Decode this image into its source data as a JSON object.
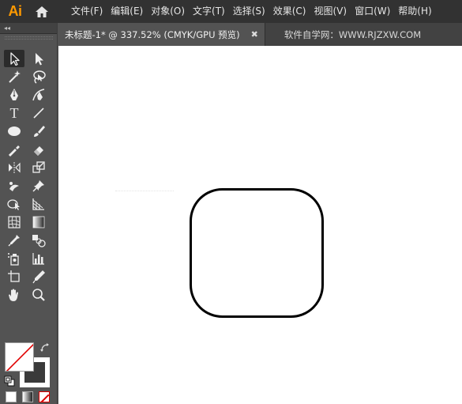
{
  "app": {
    "logo_text": "Ai",
    "home_icon": "home-icon"
  },
  "menu": [
    {
      "label": "文件(F)"
    },
    {
      "label": "编辑(E)"
    },
    {
      "label": "对象(O)"
    },
    {
      "label": "文字(T)"
    },
    {
      "label": "选择(S)"
    },
    {
      "label": "效果(C)"
    },
    {
      "label": "视图(V)"
    },
    {
      "label": "窗口(W)"
    },
    {
      "label": "帮助(H)"
    }
  ],
  "toolpanel": {
    "collapse_label": "◂◂",
    "tools": [
      {
        "name": "selection-tool-icon",
        "active": true
      },
      {
        "name": "direct-selection-tool-icon"
      },
      {
        "name": "magic-wand-tool-icon"
      },
      {
        "name": "lasso-tool-icon"
      },
      {
        "name": "pen-tool-icon"
      },
      {
        "name": "curvature-tool-icon"
      },
      {
        "name": "type-tool-icon",
        "glyph": "T"
      },
      {
        "name": "line-segment-tool-icon"
      },
      {
        "name": "ellipse-tool-icon"
      },
      {
        "name": "paintbrush-tool-icon"
      },
      {
        "name": "shaper-tool-icon"
      },
      {
        "name": "eraser-tool-icon"
      },
      {
        "name": "reflect-tool-icon"
      },
      {
        "name": "scale-tool-icon"
      },
      {
        "name": "puppet-warp-tool-icon"
      },
      {
        "name": "pin-tool-icon"
      },
      {
        "name": "shape-builder-tool-icon"
      },
      {
        "name": "perspective-grid-tool-icon"
      },
      {
        "name": "mesh-tool-icon"
      },
      {
        "name": "gradient-tool-icon"
      },
      {
        "name": "eyedropper-tool-icon"
      },
      {
        "name": "blend-tool-icon"
      },
      {
        "name": "symbol-sprayer-tool-icon"
      },
      {
        "name": "column-graph-tool-icon"
      },
      {
        "name": "artboard-tool-icon"
      },
      {
        "name": "slice-tool-icon"
      },
      {
        "name": "hand-tool-icon"
      },
      {
        "name": "zoom-tool-icon"
      }
    ]
  },
  "document": {
    "tab_label": "未标题-1* @ 337.52% (CMYK/GPU 预览)",
    "close_glyph": "✖",
    "watermark": "软件自学网：WWW.RJZXW.COM"
  },
  "colors": {
    "menubar_bg": "#323232",
    "panel_bg": "#535353",
    "accent_logo": "#FF9A00",
    "canvas_bg": "#FFFFFF",
    "none_swatch": "#D00000"
  },
  "fill_stroke": {
    "fill": "none",
    "stroke": "black"
  }
}
